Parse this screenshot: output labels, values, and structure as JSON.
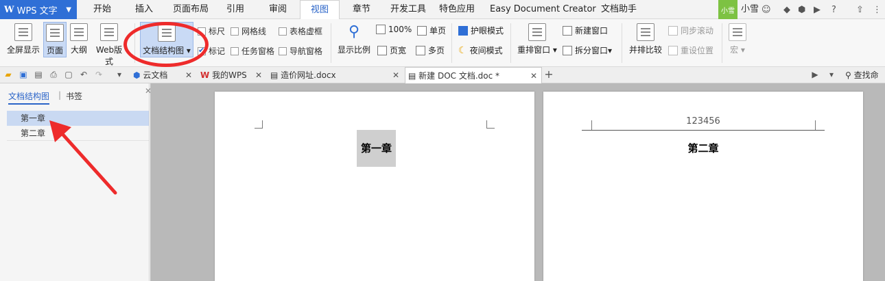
{
  "menubar": {
    "app_title": "WPS 文字",
    "tabs": [
      "开始",
      "插入",
      "页面布局",
      "引用",
      "审阅",
      "视图",
      "章节",
      "开发工具",
      "特色应用",
      "Easy Document Creator",
      "文档助手"
    ],
    "active_tab": "视图",
    "user_badge": "小雪",
    "user_name": "小雪"
  },
  "ribbon": {
    "fullscreen": "全屏显示",
    "page": "页面",
    "outline": "大纲",
    "web": "Web版式",
    "doc_structure": "文档结构图",
    "ruler": "标尺",
    "gridlines": "网格线",
    "table_gridlines": "表格虚框",
    "marks": "标记",
    "task_pane": "任务窗格",
    "nav_pane": "导航窗格",
    "zoom": "显示比例",
    "zoom_100": "100%",
    "page_width": "页宽",
    "single_page": "单页",
    "multi_page": "多页",
    "eye_mode": "护眼模式",
    "night_mode": "夜间模式",
    "arrange_windows": "重排窗口",
    "new_window": "新建窗口",
    "split_window": "拆分窗口",
    "side_by_side": "并排比较",
    "sync_scroll": "同步滚动",
    "reset_position": "重设位置",
    "macro": "宏"
  },
  "tabs": {
    "cloud": "云文档",
    "mywps": "我的WPS",
    "doc1": "造价网址.docx",
    "doc2": "新建 DOC 文档.doc *",
    "find": "查找命令"
  },
  "navpane": {
    "tab_structure": "文档结构图",
    "tab_bookmark": "书签",
    "items": [
      "第一章",
      "第二章"
    ]
  },
  "document": {
    "page1_heading": "第一章",
    "page2_header": "123456",
    "page2_heading": "第二章"
  },
  "colors": {
    "accent": "#2f6fd6",
    "annotation": "#ee2b2b"
  }
}
